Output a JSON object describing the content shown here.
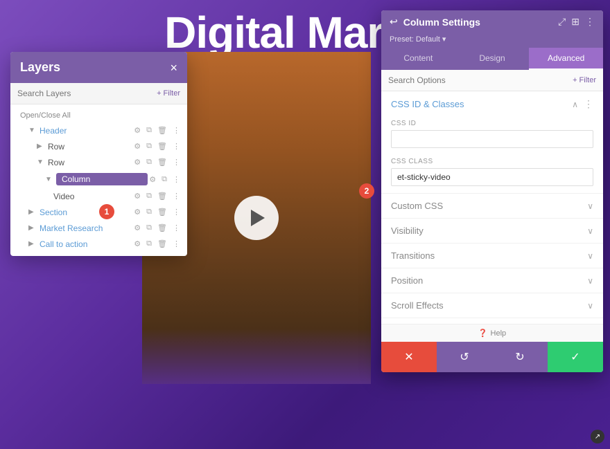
{
  "page": {
    "title": "Digital Market",
    "bg_color": "#6b3fa0"
  },
  "layers_panel": {
    "title": "Layers",
    "close_label": "×",
    "search_placeholder": "Search Layers",
    "filter_label": "+ Filter",
    "open_close_all": "Open/Close All",
    "items": [
      {
        "id": "header",
        "label": "Header",
        "indent": 1,
        "toggle": "▼",
        "is_blue": true
      },
      {
        "id": "row1",
        "label": "Row",
        "indent": 2,
        "toggle": "▶",
        "is_blue": false
      },
      {
        "id": "row2",
        "label": "Row",
        "indent": 2,
        "toggle": "▼",
        "is_blue": false
      },
      {
        "id": "column",
        "label": "Column",
        "indent": 3,
        "toggle": "▼",
        "is_highlighted": true
      },
      {
        "id": "video",
        "label": "Video",
        "indent": 4,
        "toggle": "",
        "is_blue": false
      },
      {
        "id": "section",
        "label": "Section",
        "indent": 1,
        "toggle": "▶",
        "is_blue": true
      },
      {
        "id": "market_research",
        "label": "Market Research",
        "indent": 1,
        "toggle": "▶",
        "is_blue": true
      },
      {
        "id": "call_to_action",
        "label": "Call to action",
        "indent": 1,
        "toggle": "▶",
        "is_blue": true
      }
    ]
  },
  "settings_panel": {
    "title": "Column Settings",
    "preset_label": "Preset: Default ▾",
    "back_icon": "↩",
    "tabs": [
      {
        "id": "content",
        "label": "Content",
        "active": false
      },
      {
        "id": "design",
        "label": "Design",
        "active": false
      },
      {
        "id": "advanced",
        "label": "Advanced",
        "active": true
      }
    ],
    "search_placeholder": "Search Options",
    "filter_label": "+ Filter",
    "sections": [
      {
        "id": "css_id_classes",
        "title": "CSS ID & Classes",
        "color": "blue",
        "expanded": true,
        "fields": [
          {
            "id": "css_id",
            "label": "CSS ID",
            "value": "",
            "placeholder": ""
          },
          {
            "id": "css_class",
            "label": "CSS Class",
            "value": "et-sticky-video",
            "placeholder": ""
          }
        ]
      },
      {
        "id": "custom_css",
        "title": "Custom CSS",
        "color": "grey",
        "expanded": false
      },
      {
        "id": "visibility",
        "title": "Visibility",
        "color": "grey",
        "expanded": false
      },
      {
        "id": "transitions",
        "title": "Transitions",
        "color": "grey",
        "expanded": false
      },
      {
        "id": "position",
        "title": "Position",
        "color": "grey",
        "expanded": false
      },
      {
        "id": "scroll_effects",
        "title": "Scroll Effects",
        "color": "grey",
        "expanded": false
      }
    ],
    "help_label": "Help",
    "footer_buttons": {
      "cancel_label": "✕",
      "undo_label": "↺",
      "redo_label": "↻",
      "save_label": "✓"
    }
  },
  "badges": {
    "badge1": "1",
    "badge2": "2"
  }
}
